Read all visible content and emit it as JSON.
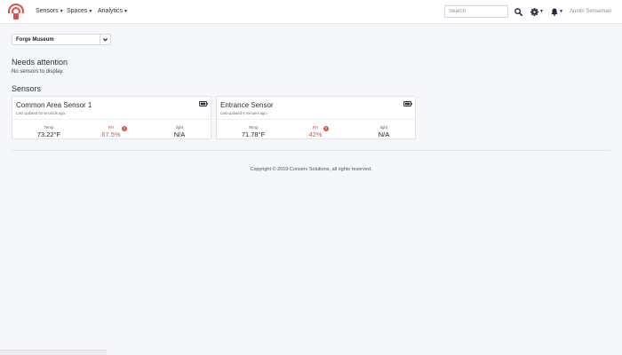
{
  "navbar": {
    "menus": [
      {
        "label": "Sensors"
      },
      {
        "label": "Spaces"
      },
      {
        "label": "Analytics"
      }
    ],
    "search_placeholder": "Search",
    "user_name": "Austin Senseman",
    "icons": [
      "logo-icon",
      "search-icon",
      "gear-icon",
      "bell-icon"
    ],
    "accent_color": "#d74f4f"
  },
  "space_select": {
    "value": "Forge Museum"
  },
  "needs_attention": {
    "title": "Needs attention",
    "empty_text": "No sensors to display."
  },
  "sensors": {
    "title": "Sensors",
    "cards": [
      {
        "name": "Common Area Sensor 1",
        "updated": "Last updated 54 seconds ago.",
        "metrics": [
          {
            "label": "Temp",
            "value": "73.22°F",
            "alert": false
          },
          {
            "label": "RH",
            "value": "67.5%",
            "alert": true
          },
          {
            "label": "light",
            "value": "N/A",
            "alert": false
          }
        ]
      },
      {
        "name": "Entrance Sensor",
        "updated": "Last updated 6 minutes ago.",
        "metrics": [
          {
            "label": "Temp",
            "value": "71.78°F",
            "alert": false
          },
          {
            "label": "RH",
            "value": "42%",
            "alert": true
          },
          {
            "label": "light",
            "value": "N/A",
            "alert": false
          }
        ]
      }
    ],
    "alert_color": "#d9534f"
  },
  "footer": {
    "copyright": "Copyright © 2019 Conserv Solutions, all rights reserved."
  }
}
